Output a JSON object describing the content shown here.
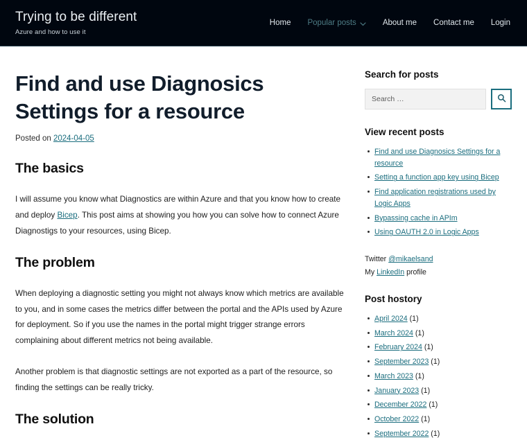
{
  "header": {
    "site_title": "Trying to be different",
    "site_description": "Azure and how to use it",
    "nav": [
      {
        "label": "Home",
        "dim": false,
        "caret": false
      },
      {
        "label": "Popular posts",
        "dim": true,
        "caret": true
      },
      {
        "label": "About me",
        "dim": false,
        "caret": false
      },
      {
        "label": "Contact me",
        "dim": false,
        "caret": false
      },
      {
        "label": "Login",
        "dim": false,
        "caret": false
      }
    ]
  },
  "article": {
    "title": "Find and use Diagnosics Settings for a resource",
    "meta_prefix": "Posted on ",
    "date": "2024-04-05",
    "sections": [
      {
        "heading": "The basics",
        "paragraphs": [
          "I will assume you know what Diagnostics are within Azure and that you know how to create and deploy Bicep. This post aims at showing you how you can solve how to connect Azure Diagnostigs to your resources, using Bicep."
        ]
      },
      {
        "heading": "The problem",
        "paragraphs": [
          "When deploying a diagnostic setting you might not always know which metrics are available to you, and in some cases the metrics differ between the portal and the APIs used by Azure for deployment. So if you use the names in the portal might trigger strange errors complaining about different metrics not being available.",
          "Another problem is that diagnostic settings are not exported as a part of the resource, so finding the settings can be really tricky."
        ]
      },
      {
        "heading": "The solution",
        "paragraphs": []
      }
    ],
    "inline_link": "Bicep"
  },
  "sidebar": {
    "search": {
      "title": "Search for posts",
      "placeholder": "Search …",
      "value": "",
      "button_icon": "search-icon"
    },
    "recent": {
      "title": "View recent posts",
      "items": [
        "Find and use Diagnosics Settings for a resource",
        "Setting a function app key using Bicep",
        "Find application registrations used by Logic Apps",
        "Bypassing cache in APIm",
        "Using OAUTH 2.0 in Logic Apps"
      ]
    },
    "social": {
      "twitter_label": "Twitter ",
      "twitter_handle": "@mikaelsand",
      "linkedin_prefix": "My ",
      "linkedin_label": "LinkedIn",
      "linkedin_suffix": " profile"
    },
    "archive": {
      "title": "Post hostory",
      "items": [
        {
          "label": "April 2024",
          "count": "(1)"
        },
        {
          "label": "March 2024",
          "count": "(1)"
        },
        {
          "label": "February 2024",
          "count": "(1)"
        },
        {
          "label": "September 2023",
          "count": "(1)"
        },
        {
          "label": "March 2023",
          "count": "(1)"
        },
        {
          "label": "January 2023",
          "count": "(1)"
        },
        {
          "label": "December 2022",
          "count": "(1)"
        },
        {
          "label": "October 2022",
          "count": "(1)"
        },
        {
          "label": "September 2022",
          "count": "(1)"
        }
      ]
    }
  },
  "colors": {
    "header_bg": "#00060f",
    "accent_link": "#1a6d7e",
    "title_text": "#111d2b",
    "search_bg": "#f2f2f2"
  }
}
